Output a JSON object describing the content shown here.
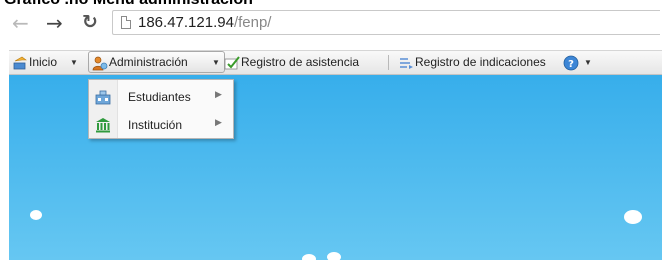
{
  "caption": "Gráfico  .no Menú administración",
  "browser": {
    "url_host": "186.47.121.94",
    "url_path": "/fenp/"
  },
  "toolbar": {
    "inicio": "Inicio",
    "administracion": "Administración",
    "registro_asistencia": "Registro de asistencia",
    "registro_indicaciones": "Registro de indicaciones"
  },
  "dropdown": {
    "items": [
      {
        "label": "Estudiantes"
      },
      {
        "label": "Institución"
      }
    ]
  },
  "colors": {
    "content_top": "#37aeeb",
    "content_bottom": "#66c7f2",
    "toolbar_bg": "#eeeeee"
  },
  "icons": {
    "inicio": "home-arrow-icon",
    "administracion": "user-settings-icon",
    "registro_asistencia": "checklist-icon",
    "registro_indicaciones": "notes-icon",
    "help": "help-icon",
    "estudiantes": "students-icon",
    "institucion": "building-icon"
  }
}
